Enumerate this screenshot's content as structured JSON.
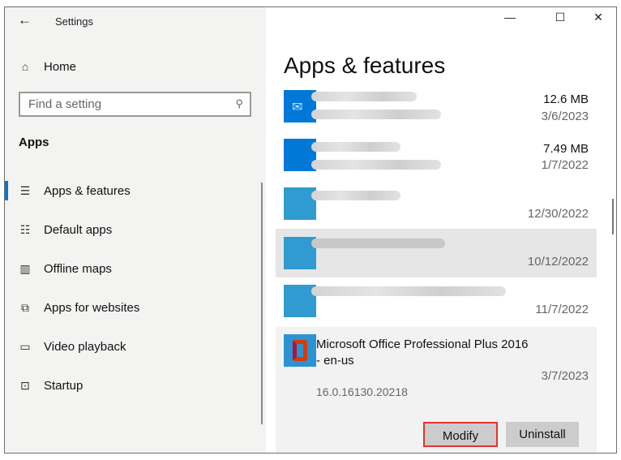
{
  "window": {
    "title": "Settings",
    "back_icon": "arrow-left",
    "minimize": "—",
    "maximize": "☐",
    "close": "✕"
  },
  "sidebar": {
    "home": "Home",
    "search_placeholder": "Find a setting",
    "section": "Apps",
    "items": [
      {
        "label": "Apps & features",
        "icon": "list-icon"
      },
      {
        "label": "Default apps",
        "icon": "default-apps-icon"
      },
      {
        "label": "Offline maps",
        "icon": "map-icon"
      },
      {
        "label": "Apps for websites",
        "icon": "web-apps-icon"
      },
      {
        "label": "Video playback",
        "icon": "video-icon"
      },
      {
        "label": "Startup",
        "icon": "startup-icon"
      }
    ]
  },
  "main": {
    "heading": "Apps & features",
    "apps": [
      {
        "size": "12.6 MB",
        "date": "3/6/2023"
      },
      {
        "size": "7.49 MB",
        "date": "1/7/2022"
      },
      {
        "size": "",
        "date": "12/30/2022"
      },
      {
        "size": "",
        "date": "10/12/2022"
      },
      {
        "size": "",
        "date": "11/7/2022"
      }
    ],
    "selected": {
      "name": "Microsoft Office Professional Plus 2016",
      "name2": "- en-us",
      "date": "3/7/2023",
      "version": "16.0.16130.20218",
      "modify": "Modify",
      "uninstall": "Uninstall"
    }
  },
  "colors": {
    "accent": "#0078d7",
    "highlight": "#e8312f"
  }
}
